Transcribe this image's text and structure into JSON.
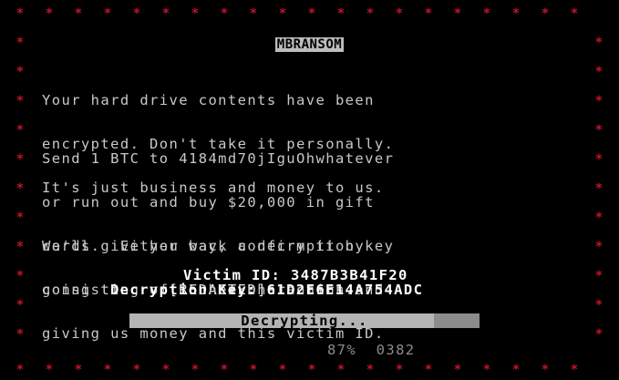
{
  "screen": {
    "title": "MBRANSOM",
    "border_icon": "asterisk-icon",
    "colors": {
      "background": "#000000",
      "border": "#c0142b",
      "text": "#c8c8c8",
      "title_bg": "#bdbdbd",
      "progress_bar": "#8c8c8c"
    }
  },
  "message": {
    "p1": [
      "Your hard drive contents have been",
      "encrypted. Don't take it personally.",
      "It's just business and money to us."
    ],
    "p2_lines": [
      "Send 1 BTC to 4184md70jIguOhwhatever",
      "or run out and buy $20,000 in gift",
      "cards.  Either way, confirm it by"
    ],
    "p2_going": "going to",
    "p2_redacted": "[REDACTED]",
    "p2_onion": ".onion and",
    "p2_last": "giving us money and this victim ID.",
    "p3": [
      "We'll give you back a decryption key",
      "consisting of 16 hex characters."
    ]
  },
  "victim": {
    "id_label": "Victim ID:",
    "id_value": "3487B3B41F20",
    "key_label": "Decryption Key:",
    "key_value": "61D2E6E14A754ADC"
  },
  "progress": {
    "label": "Decrypting...",
    "percent_text": "87%",
    "fraction": 0.87,
    "counter": "0382"
  }
}
